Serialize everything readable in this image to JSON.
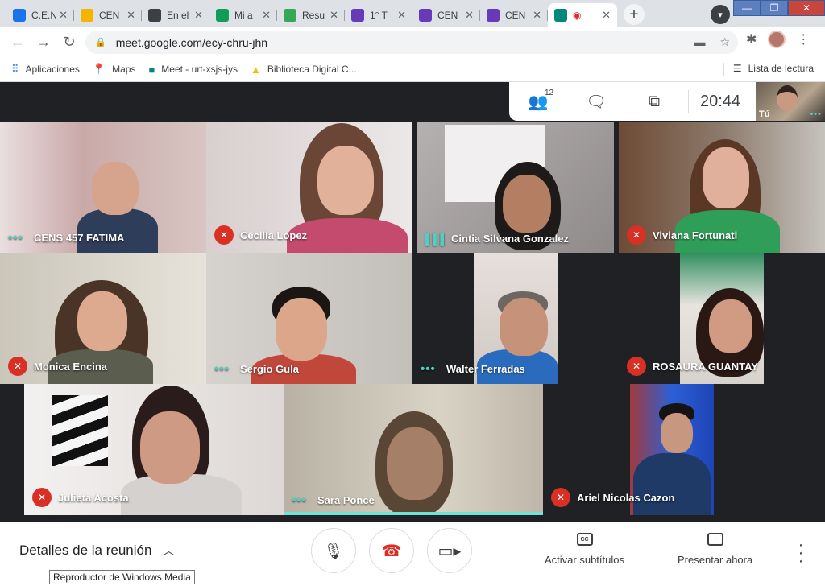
{
  "tabs": [
    {
      "label": "C.E.N",
      "color": "#1a73e8"
    },
    {
      "label": "CEN",
      "color": "#f4b400"
    },
    {
      "label": "En el",
      "color": "#3c4043"
    },
    {
      "label": "Mi a",
      "color": "#0f9d58"
    },
    {
      "label": "Resu",
      "color": "#34a853"
    },
    {
      "label": "1° T",
      "color": "#673ab7"
    },
    {
      "label": "CEN",
      "color": "#673ab7"
    },
    {
      "label": "CEN",
      "color": "#673ab7"
    },
    {
      "label": "",
      "color": "#00897b",
      "active": true
    }
  ],
  "url": "meet.google.com/ecy-chru-jhn",
  "bookmarks": {
    "apps": "Aplicaciones",
    "maps": "Maps",
    "meet": "Meet - urt-xsjs-jys",
    "biblioteca": "Biblioteca Digital C...",
    "reading_list": "Lista de lectura"
  },
  "meet": {
    "participant_count": "12",
    "time": "20:44",
    "self_label": "Tú"
  },
  "participants": [
    {
      "name": "CENS 457 FATIMA",
      "status": "dots"
    },
    {
      "name": "Cecilia Lopez",
      "status": "muted"
    },
    {
      "name": "Cintia Silvana Gonzalez",
      "status": "speaking"
    },
    {
      "name": "Viviana Fortunati",
      "status": "muted"
    },
    {
      "name": "Monica Encina",
      "status": "muted"
    },
    {
      "name": "Sergio Gula",
      "status": "dots"
    },
    {
      "name": "Walter Ferradas",
      "status": "dots"
    },
    {
      "name": "ROSAURA GUANTAY",
      "status": "muted"
    },
    {
      "name": "Julieta Acosta",
      "status": "muted"
    },
    {
      "name": "Sara Ponce",
      "status": "dots"
    },
    {
      "name": "Ariel Nicolas Cazon",
      "status": "muted"
    }
  ],
  "controls": {
    "meeting_details": "Detalles de la reunión",
    "captions": "Activar subtítulos",
    "present": "Presentar ahora",
    "captions_icon": "CC"
  },
  "tooltip": "Reproductor de Windows Media"
}
